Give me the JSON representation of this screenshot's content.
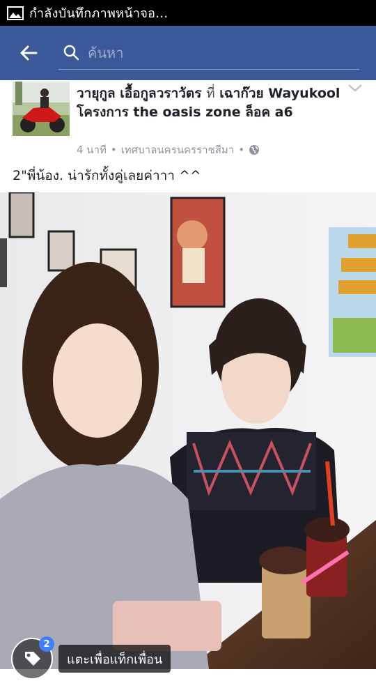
{
  "status_bar": {
    "text": "กำลังบันทึกภาพหน้าจอ...",
    "icon": "image-icon"
  },
  "header": {
    "back_icon": "back-arrow-icon",
    "search_icon": "search-icon",
    "search_placeholder": "ค้นหา",
    "background": "#3b5998"
  },
  "post": {
    "author": "วายุกูล เอื้อกูลวราวัตร",
    "at_word": "ที่",
    "place": "เฉาก๊วย Wayukool โครงการ the oasis zone ล็อค a6",
    "time": "4 นาที",
    "location": "เทศบาลนครนครราชสีมา",
    "privacy_icon": "globe-icon",
    "caption": "2\"พี่น้อง. น่ารักทั้งคู่เลยค่าาา ^^"
  },
  "tag": {
    "badge_count": "2",
    "label": "แตะเพื่อแท็กเพื่อน",
    "icon": "tag-icon"
  }
}
